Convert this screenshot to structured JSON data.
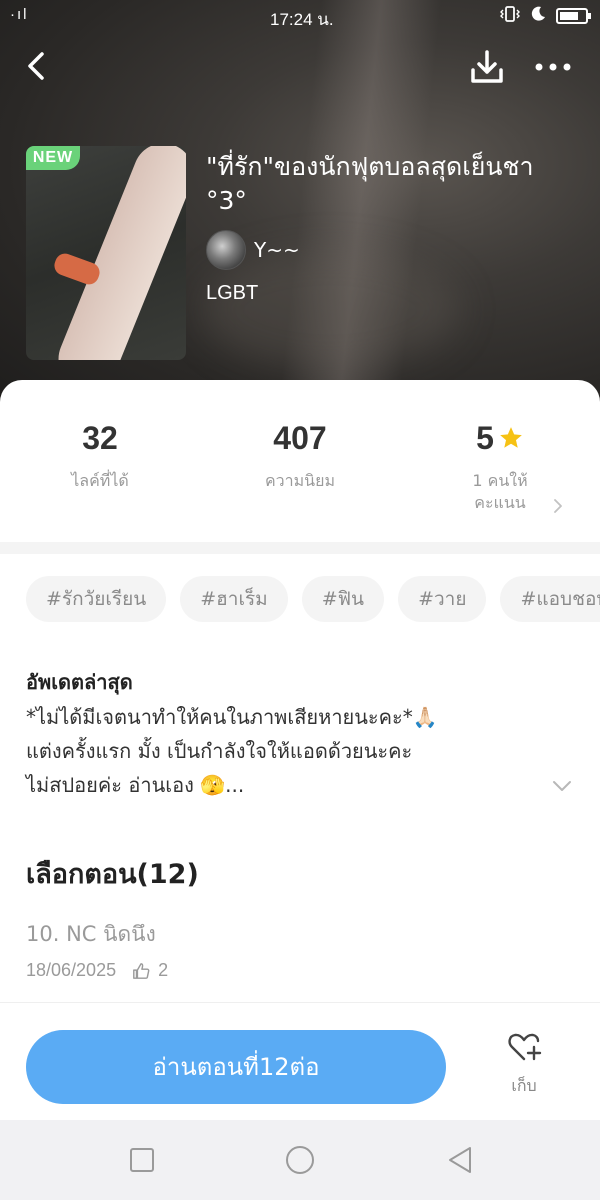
{
  "status_bar": {
    "time": "17:24 น.",
    "signal": "·ıl"
  },
  "header": {
    "cover_badge": "NEW",
    "title": "\"ที่รัก\"ของนักฟุตบอลสุดเย็นชา °3°",
    "author": "Y~~",
    "genre": "LGBT"
  },
  "stats": {
    "likes_value": "32",
    "likes_label": "ไลค์ที่ได้",
    "popularity_value": "407",
    "popularity_label": "ความนิยม",
    "rating_value": "5",
    "rating_label_line1": "1 คนให้",
    "rating_label_line2": "คะแนน"
  },
  "tags": [
    "#รักวัยเรียน",
    "#ฮาเร็ม",
    "#ฟิน",
    "#วาย",
    "#แอบชอบ"
  ],
  "update": {
    "heading": "อัพเดตล่าสุด",
    "line1": "*ไม่ได้มีเจตนาทำให้คนในภาพเสียหายนะคะ*🙏🏻",
    "line2": "แต่งครั้งแรก มั้ง เป็นกำลังใจให้แอดด้วยนะคะ",
    "line3": "ไม่สปอยค่ะ อ่านเอง 🫣..."
  },
  "episodes": {
    "heading": "เลือกตอน(12)",
    "item_title": "10. NC นิดนึง",
    "item_date": "18/06/2025",
    "item_likes": "2"
  },
  "actions": {
    "read_label": "อ่านตอนที่12ต่อ",
    "save_label": "เก็บ"
  },
  "colors": {
    "accent": "#5aabf4",
    "badge_green": "#6ad27a",
    "star": "#f6c214"
  },
  "icons": [
    "back-arrow-icon",
    "download-icon",
    "more-icon",
    "star-icon",
    "chevron-right-icon",
    "chevron-down-icon",
    "thumbs-up-icon",
    "heart-plus-icon",
    "nav-square-icon",
    "nav-circle-icon",
    "nav-triangle-icon"
  ]
}
